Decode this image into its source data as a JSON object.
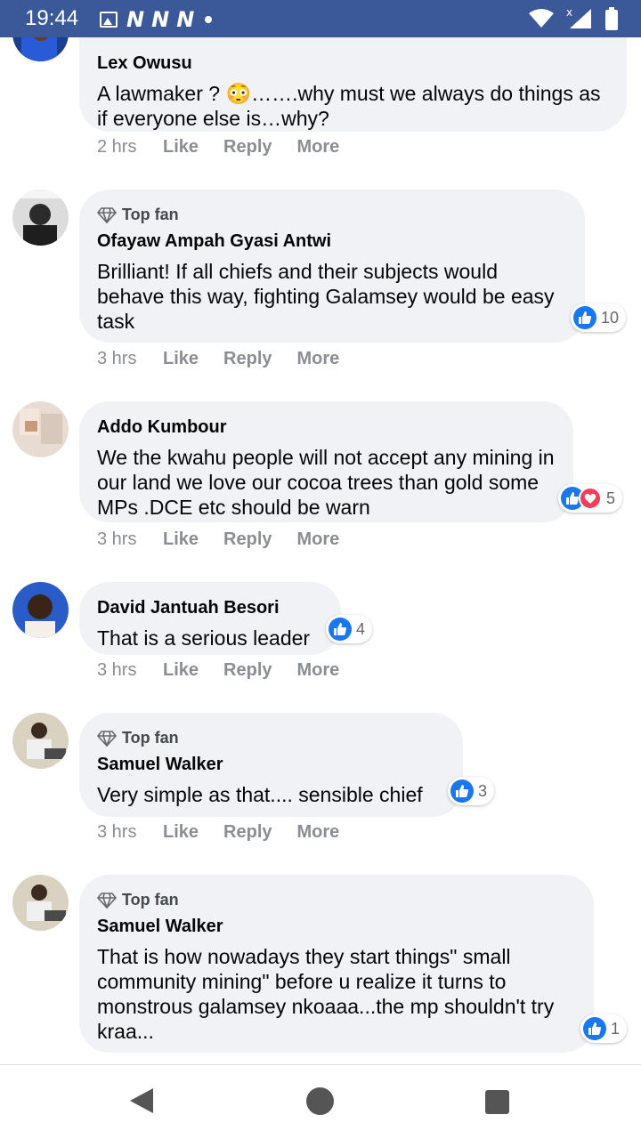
{
  "status_bar": {
    "time": "19:44",
    "left_icons": [
      "image-icon",
      "n-app-icon",
      "n-app-icon",
      "n-app-icon",
      "dot-icon"
    ],
    "right_icons": [
      "wifi-icon",
      "signal-icon",
      "battery-icon"
    ],
    "bg_color": "#3b5998"
  },
  "comments": [
    {
      "author": "Lex Owusu",
      "top_fan": false,
      "text": "A lawmaker ? 😳…….why must we always do things as if everyone else is…why?",
      "time": "2 hrs",
      "like": "Like",
      "reply": "Reply",
      "more": "More"
    },
    {
      "author": "Ofayaw Ampah Gyasi Antwi",
      "top_fan": true,
      "badge": "Top fan",
      "text": "Brilliant! If all chiefs and their subjects would behave this way, fighting Galamsey would be easy task",
      "reactions": [
        "like"
      ],
      "reaction_count": "10",
      "time": "3 hrs",
      "like": "Like",
      "reply": "Reply",
      "more": "More"
    },
    {
      "author": "Addo Kumbour",
      "top_fan": false,
      "text": "We the kwahu people will not accept any mining in our land we love our cocoa trees than gold some MPs .DCE etc should be warn",
      "reactions": [
        "like",
        "love"
      ],
      "reaction_count": "5",
      "time": "3 hrs",
      "like": "Like",
      "reply": "Reply",
      "more": "More"
    },
    {
      "author": "David Jantuah Besori",
      "top_fan": false,
      "text": "That is a serious leader",
      "reactions": [
        "like"
      ],
      "reaction_count": "4",
      "time": "3 hrs",
      "like": "Like",
      "reply": "Reply",
      "more": "More"
    },
    {
      "author": "Samuel Walker",
      "top_fan": true,
      "badge": "Top fan",
      "text": "Very simple as that.... sensible chief",
      "reactions": [
        "like"
      ],
      "reaction_count": "3",
      "time": "3 hrs",
      "like": "Like",
      "reply": "Reply",
      "more": "More"
    },
    {
      "author": "Samuel Walker",
      "top_fan": true,
      "badge": "Top fan",
      "text": "That is how nowadays they start things\" small community mining\" before u realize it turns to monstrous galamsey nkoaaa...the mp shouldn't try kraa...",
      "reactions": [
        "like"
      ],
      "reaction_count": "1"
    }
  ],
  "nav_bar": {
    "buttons": [
      "back-button",
      "home-button",
      "recents-button"
    ]
  },
  "colors": {
    "bubble": "#f0f2f5",
    "like_blue": "#1877f2",
    "love_red": "#f33e58",
    "meta_gray": "#8a8d91"
  }
}
